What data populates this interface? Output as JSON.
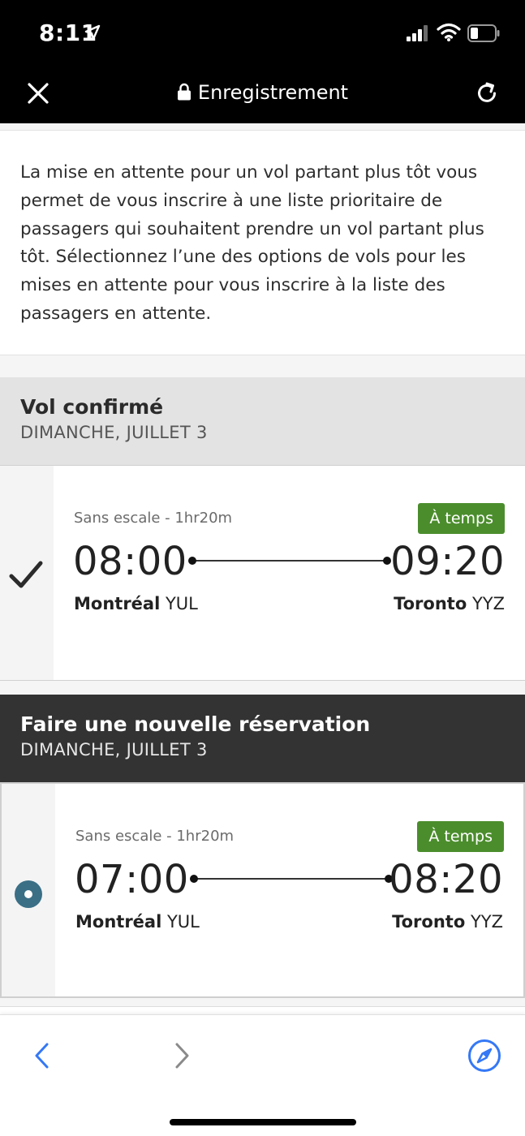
{
  "status": {
    "time": "8:11"
  },
  "nav": {
    "title": "Enregistrement"
  },
  "intro": {
    "text": "La mise en attente pour un vol partant plus tôt vous permet de vous inscrire à une liste prioritaire de passagers qui souhaitent prendre un vol partant plus tôt. Sélectionnez l’une des options de vols pour les mises en attente pour vous inscrire à la liste des passagers en attente."
  },
  "confirmed": {
    "title": "Vol confirmé",
    "date": "DIMANCHE, JUILLET 3",
    "flight": {
      "stops": "Sans escale - 1hr20m",
      "status": "À temps",
      "dep_time": "08:00",
      "arr_time": "09:20",
      "dep_city": "Montréal",
      "dep_code": "YUL",
      "arr_city": "Toronto",
      "arr_code": "YYZ"
    }
  },
  "new_booking": {
    "title": "Faire une nouvelle réservation",
    "date": "DIMANCHE, JUILLET 3",
    "flight": {
      "stops": "Sans escale - 1hr20m",
      "status": "À temps",
      "dep_time": "07:00",
      "arr_time": "08:20",
      "dep_city": "Montréal",
      "dep_code": "YUL",
      "arr_city": "Toronto",
      "arr_code": "YYZ"
    }
  },
  "colors": {
    "status_green": "#4b8d2c",
    "radio_teal": "#3a6f86",
    "safari_blue": "#3478f6",
    "dark_header": "#333333",
    "light_header": "#e3e3e3"
  },
  "icons": [
    "location-arrow-icon",
    "signal-icon",
    "wifi-icon",
    "battery-icon",
    "close-icon",
    "lock-icon",
    "reload-icon",
    "checkmark-icon",
    "radio-selected-icon",
    "back-chevron-icon",
    "forward-chevron-icon",
    "compass-icon"
  ]
}
